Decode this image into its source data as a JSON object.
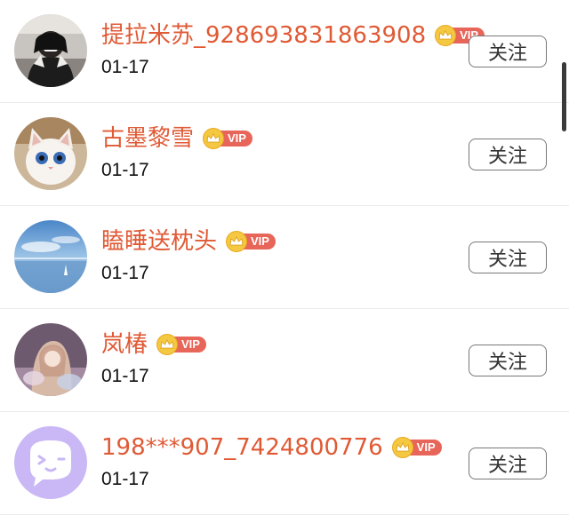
{
  "follow_label": "关注",
  "vip_label": "VIP",
  "users": [
    {
      "name": "提拉米苏_928693831863908",
      "date": "01-17",
      "avatar": "person-in-sweater-avatar"
    },
    {
      "name": "古墨黎雪",
      "date": "01-17",
      "avatar": "white-cat-avatar"
    },
    {
      "name": "瞌睡送枕头",
      "date": "01-17",
      "avatar": "sky-lake-avatar"
    },
    {
      "name": "岚椿",
      "date": "01-17",
      "avatar": "anime-girl-avatar"
    },
    {
      "name": "198***907_7424800776",
      "date": "01-17",
      "avatar": "default-chat-avatar"
    }
  ],
  "colors": {
    "name": "#e05a35",
    "vip_tag": "#e8655a",
    "crown": "#f5c842",
    "default_avatar_bg": "#c9b8f5"
  }
}
